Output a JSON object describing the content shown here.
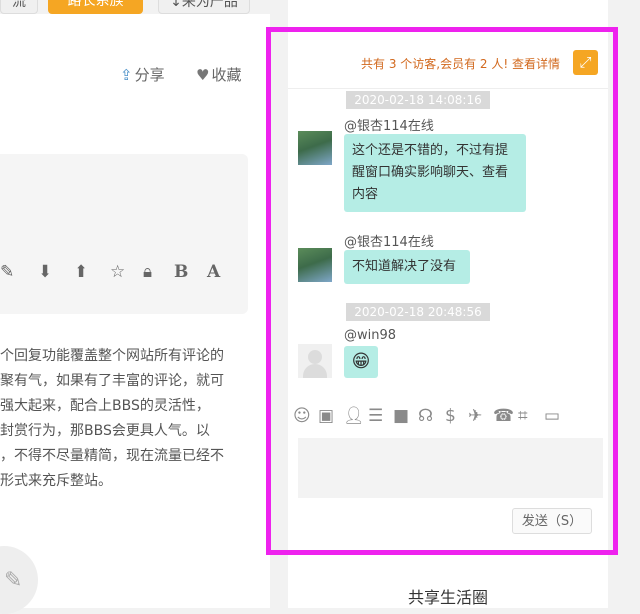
{
  "top_buttons": [
    "流",
    "路长系族",
    "↓来为产品"
  ],
  "actions": {
    "share": "分享",
    "favorite": "收藏"
  },
  "editor_tools": [
    "edit-icon",
    "arrow-down-icon",
    "arrow-up-icon",
    "star-icon",
    "lock-icon",
    "B",
    "A"
  ],
  "article_lines": [
    "个回复功能覆盖整个网站所有评论的",
    "聚有气，如果有了丰富的评论，就可",
    "强大起来，配合上BBS的灵活性，",
    "封赏行为，那BBS会更具人气。以",
    "，不得不尽量精简，现在流量已经不",
    "形式来充斥整站。"
  ],
  "chat": {
    "header_text": "共有 3 个访客,会员有 2 人! 查看详情",
    "messages": [
      {
        "time": "2020-02-18 14:08:16",
        "user": "@银杏114在线",
        "text": "这个还是不错的，不过有提醒窗口确实影响聊天、查看内容"
      },
      {
        "user": "@银杏114在线",
        "text": "不知道解决了没有"
      },
      {
        "time": "2020-02-18 20:48:56",
        "user": "@win98",
        "emoji": "😁"
      }
    ],
    "toolbar_icons": [
      "smiley-icon",
      "image-icon",
      "add-user-icon",
      "list-icon",
      "video-icon",
      "headphones-icon",
      "dollar-icon",
      "plane-icon",
      "phone-icon",
      "crop-icon",
      "monitor-icon"
    ],
    "send_label": "发送（S）"
  },
  "sidebar_title": "共享生活圈",
  "colors": {
    "highlight": "#ee22ee",
    "accent": "#f5a623",
    "bubble": "#b5ede5"
  }
}
